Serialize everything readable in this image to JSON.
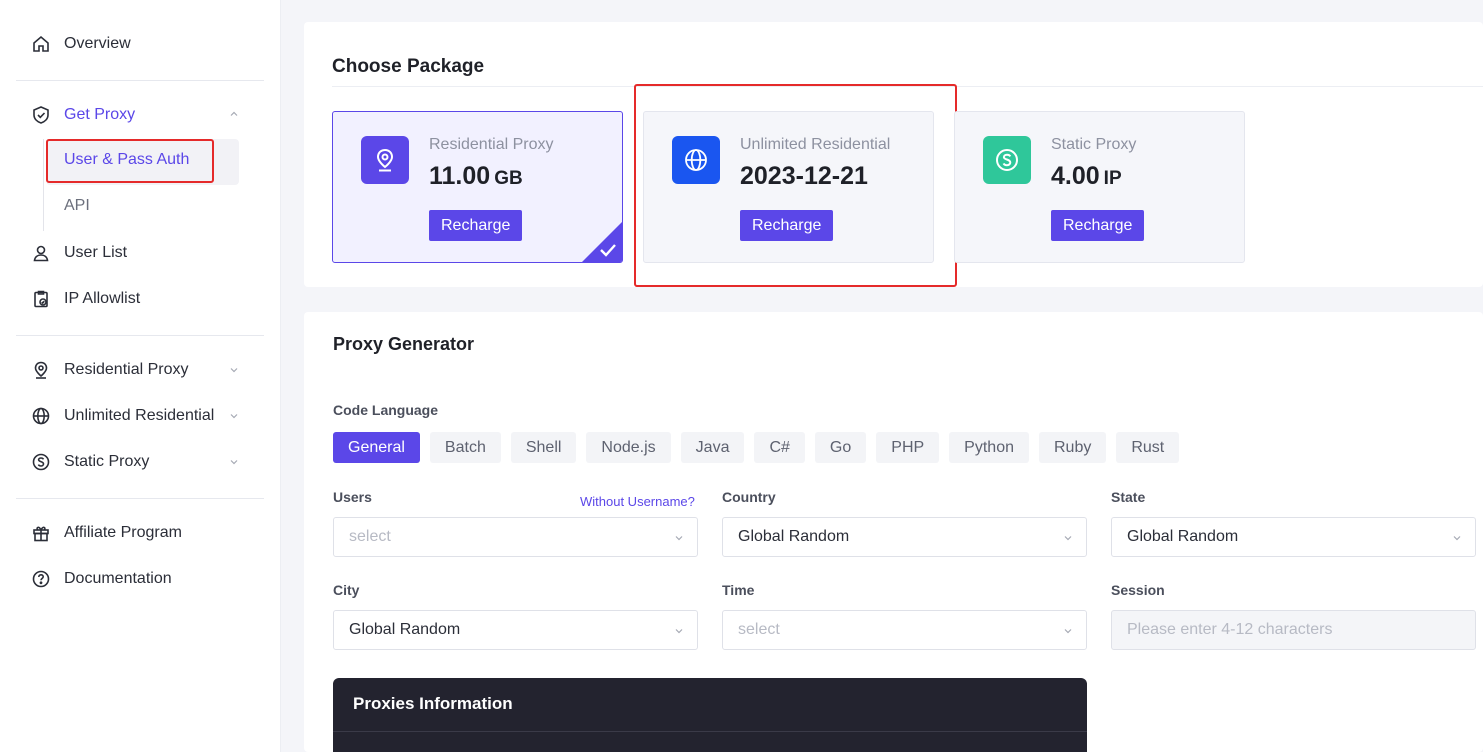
{
  "sidebar": {
    "overview": "Overview",
    "get_proxy": "Get Proxy",
    "sub_items": [
      "User & Pass Auth",
      "API"
    ],
    "user_list": "User List",
    "ip_allowlist": "IP Allowlist",
    "residential_proxy": "Residential Proxy",
    "unlimited_residential": "Unlimited Residential",
    "static_proxy": "Static Proxy",
    "affiliate_program": "Affiliate Program",
    "documentation": "Documentation"
  },
  "package": {
    "title": "Choose Package",
    "cards": [
      {
        "name": "Residential Proxy",
        "value": "11.00",
        "unit": "GB",
        "button": "Recharge",
        "color": "#5b47e8",
        "icon": "location-pin-icon",
        "selected": true
      },
      {
        "name": "Unlimited Residential",
        "value": "2023-12-21",
        "unit": "",
        "button": "Recharge",
        "color": "#1a56f0",
        "icon": "globe-icon",
        "selected": false
      },
      {
        "name": "Static Proxy",
        "value": "4.00",
        "unit": "IP",
        "button": "Recharge",
        "color": "#2fc79a",
        "icon": "dollar-icon",
        "selected": false
      }
    ]
  },
  "generator": {
    "title": "Proxy Generator",
    "code_language_label": "Code Language",
    "languages": [
      "General",
      "Batch",
      "Shell",
      "Node.js",
      "Java",
      "C#",
      "Go",
      "PHP",
      "Python",
      "Ruby",
      "Rust"
    ],
    "active_language": "General",
    "users_label": "Users",
    "without_username": "Without Username?",
    "users_placeholder": "select",
    "country_label": "Country",
    "country_value": "Global Random",
    "state_label": "State",
    "state_value": "Global Random",
    "city_label": "City",
    "city_value": "Global Random",
    "time_label": "Time",
    "time_placeholder": "select",
    "session_label": "Session",
    "session_placeholder": "Please enter 4-12 characters",
    "proxies_info_title": "Proxies Information"
  },
  "colors": {
    "accent": "#5b47e8",
    "highlight": "#e52a2a",
    "dark_panel": "#23232f"
  }
}
